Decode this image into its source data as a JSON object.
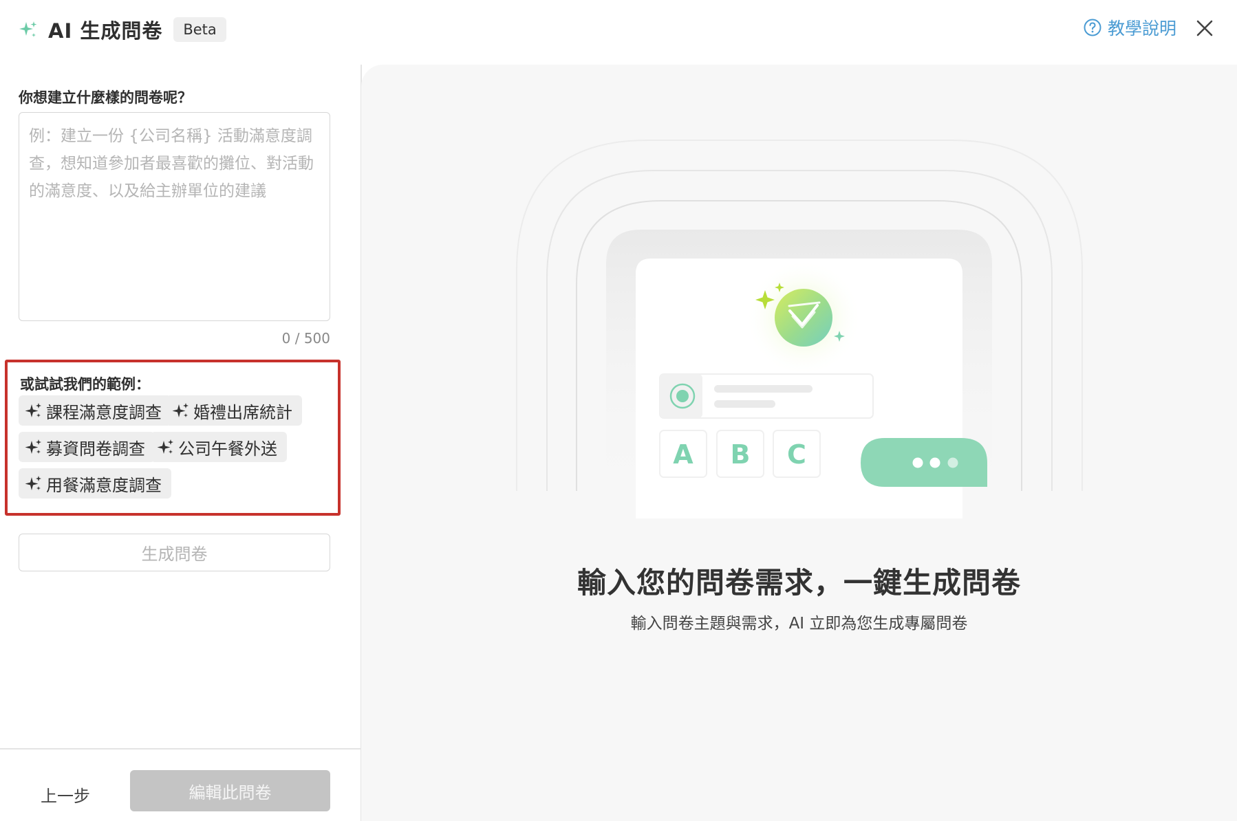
{
  "header": {
    "title": "AI 生成問卷",
    "badge": "Beta",
    "help_label": "教學說明"
  },
  "form": {
    "question_label": "你想建立什麼樣的問卷呢？",
    "prompt_value": "",
    "prompt_placeholder": "例：建立一份 {公司名稱} 活動滿意度調查，想知道參加者最喜歡的攤位、對活動的滿意度、以及給主辦單位的建議",
    "char_count": "0 / 500",
    "examples_label": "或試試我們的範例：",
    "examples": [
      {
        "label": "課程滿意度調查"
      },
      {
        "label": "婚禮出席統計"
      },
      {
        "label": "募資問卷調查"
      },
      {
        "label": "公司午餐外送"
      },
      {
        "label": "用餐滿意度調查"
      }
    ],
    "generate_label": "生成問卷"
  },
  "footer": {
    "back_label": "上一步",
    "edit_label": "編輯此問卷"
  },
  "hero": {
    "title": "輸入您的問卷需求，一鍵生成問卷",
    "subtitle": "輸入問卷主題與需求，AI 立即為您生成專屬問卷",
    "option_letters": [
      "A",
      "B",
      "C"
    ]
  },
  "colors": {
    "accent_green": "#7fd3b0",
    "highlight_red": "#c7322c",
    "link_blue": "#4a9bd3",
    "disabled_gray": "#c4c4c4"
  },
  "icons": {
    "brand": "sparkle-icon",
    "help": "question-circle-icon",
    "close": "close-icon",
    "chip": "sparkle-icon"
  }
}
